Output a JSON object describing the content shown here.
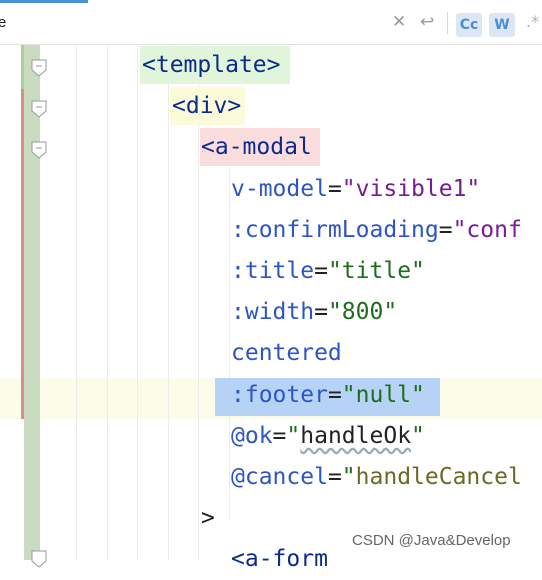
{
  "search": {
    "query": "e",
    "match_case_label": "Cc",
    "words_label": "W"
  },
  "code": {
    "line1_tag": "<template>",
    "line2_tag": "<div>",
    "line3_tag": "<a-modal",
    "line4": {
      "attr": "v-model",
      "eq": "=",
      "value": "\"visible1\""
    },
    "line5": {
      "attr": ":confirmLoading",
      "eq": "=",
      "value": "\"conf"
    },
    "line6": {
      "attr": ":title",
      "eq": "=",
      "value": "\"title\""
    },
    "line7": {
      "attr": ":width",
      "eq": "=",
      "value": "\"800\""
    },
    "line8": {
      "attr": "centered"
    },
    "line9": {
      "attr": ":footer",
      "eq": "=",
      "value": "\"null\""
    },
    "line10": {
      "attr": "@ok",
      "eq": "=",
      "q1": "\"",
      "value": "handleOk",
      "q2": "\""
    },
    "line11": {
      "attr": "@cancel",
      "eq": "=",
      "q1": "\"",
      "value": "handleCancel"
    },
    "line12": ">",
    "line13_tag": "<a-form"
  },
  "watermark": "CSDN @Java&Develop"
}
